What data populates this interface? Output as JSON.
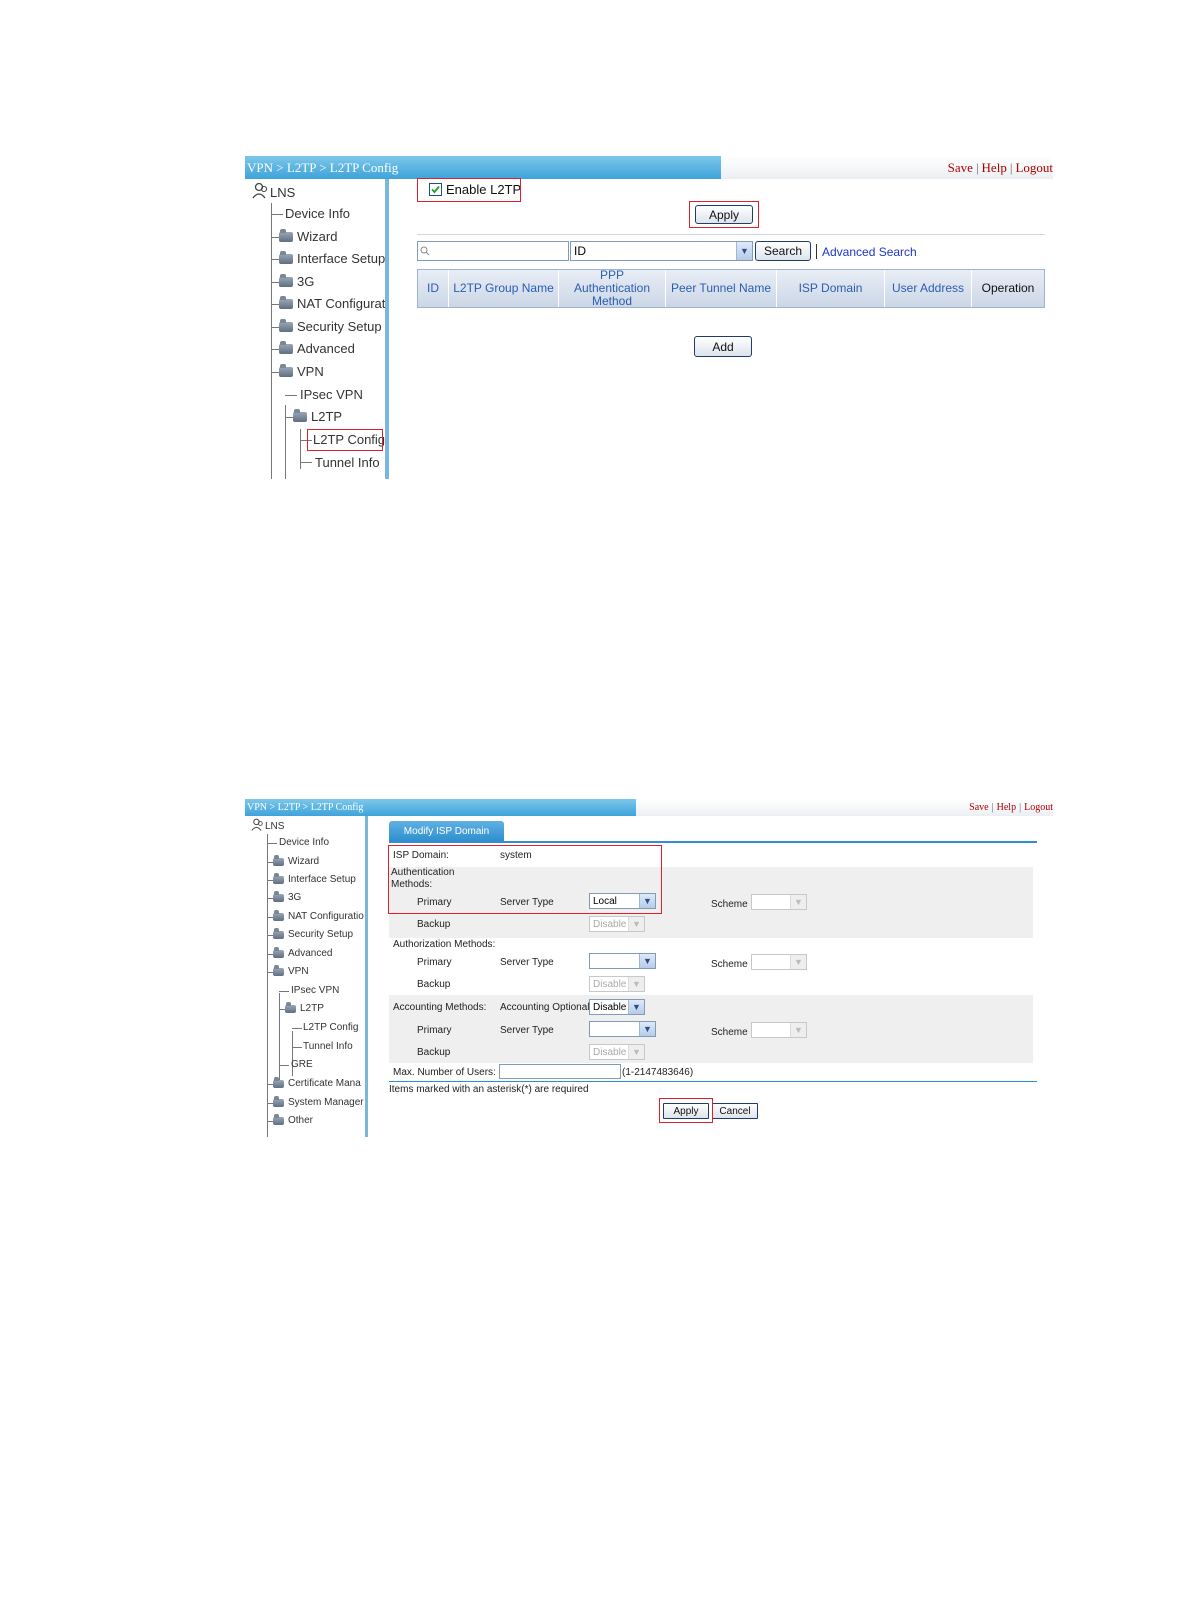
{
  "shot1": {
    "breadcrumb": "VPN > L2TP > L2TP Config",
    "top_links": [
      "Save",
      "Help",
      "Logout"
    ],
    "tree_root": "LNS",
    "tree_items": [
      "Device Info",
      "Wizard",
      "Interface Setup",
      "3G",
      "NAT Configurati",
      "Security Setup",
      "Advanced",
      "VPN",
      "IPsec VPN",
      "L2TP",
      "L2TP Config",
      "Tunnel Info"
    ],
    "enable_l2tp_label": "Enable L2TP",
    "enable_l2tp_checked": true,
    "apply_label": "Apply",
    "search_placeholder": "",
    "search_field_value": "ID",
    "search_button": "Search",
    "advanced_search": "Advanced Search",
    "columns": [
      "ID",
      "L2TP Group Name",
      "PPP Authentication Method",
      "Peer Tunnel Name",
      "ISP Domain",
      "User Address",
      "Operation"
    ],
    "add_label": "Add"
  },
  "shot2": {
    "breadcrumb": "VPN > L2TP > L2TP Config",
    "top_links": [
      "Save",
      "Help",
      "Logout"
    ],
    "tree_root": "LNS",
    "tree_items": [
      "Device Info",
      "Wizard",
      "Interface Setup",
      "3G",
      "NAT Configuratio",
      "Security Setup",
      "Advanced",
      "VPN",
      "IPsec VPN",
      "L2TP",
      "L2TP Config",
      "Tunnel Info",
      "GRE",
      "Certificate Mana",
      "System Manager",
      "Other"
    ],
    "tab_label": "Modify ISP Domain",
    "isp_domain_label": "ISP Domain:",
    "isp_domain_value": "system",
    "auth_methods_label": "Authentication Methods:",
    "authz_methods_label": "Authorization Methods:",
    "acct_methods_label": "Accounting Methods:",
    "acct_optional_label": "Accounting Optional",
    "acct_optional_value": "Disable",
    "primary_label": "Primary",
    "backup_label": "Backup",
    "server_type_label": "Server Type",
    "scheme_label": "Scheme",
    "auth_primary_value": "Local",
    "backup_value": "Disable",
    "max_users_label": "Max. Number of Users:",
    "max_users_range": "(1-2147483646)",
    "required_note": "Items marked with an asterisk(*) are required",
    "apply_label": "Apply",
    "cancel_label": "Cancel"
  }
}
